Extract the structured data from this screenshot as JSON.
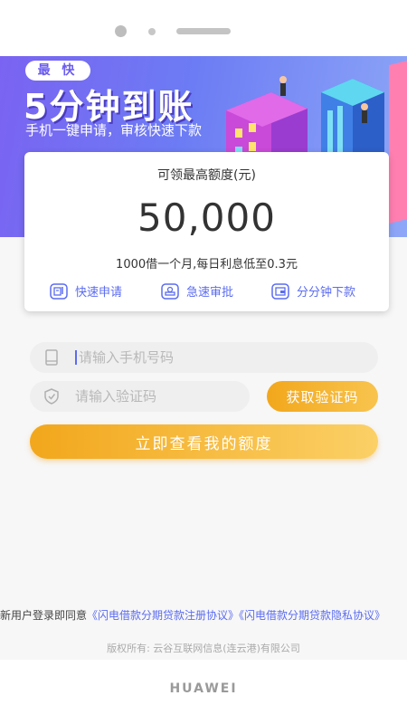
{
  "banner": {
    "badge": "最 快",
    "headline": "5分钟到账",
    "subline": "手机一键申请，审核快速下款"
  },
  "card": {
    "label": "可领最高额度(元)",
    "amount": "50,000",
    "description": "1000借一个月,每日利息低至0.3元",
    "features": [
      {
        "label": "快速申请",
        "icon": "form-icon"
      },
      {
        "label": "急速审批",
        "icon": "stamp-icon"
      },
      {
        "label": "分分钟下款",
        "icon": "wallet-icon"
      }
    ]
  },
  "form": {
    "phone_placeholder": "请输入手机号码",
    "code_placeholder": "请输入验证码",
    "get_code_label": "获取验证码",
    "submit_label": "立即查看我的额度"
  },
  "agreement": {
    "prefix": "新用户登录即同意",
    "link1": "《闪电借款分期贷款注册协议》",
    "link2": "《闪电借款分期贷款隐私协议》"
  },
  "copyright": "版权所有: 云谷互联网信息(连云港)有限公司",
  "device_brand": "HUAWEI",
  "colors": {
    "accent_blue": "#5b6cf0",
    "banner_purple": "#7a63f2",
    "button_orange": "#f2a71c"
  }
}
